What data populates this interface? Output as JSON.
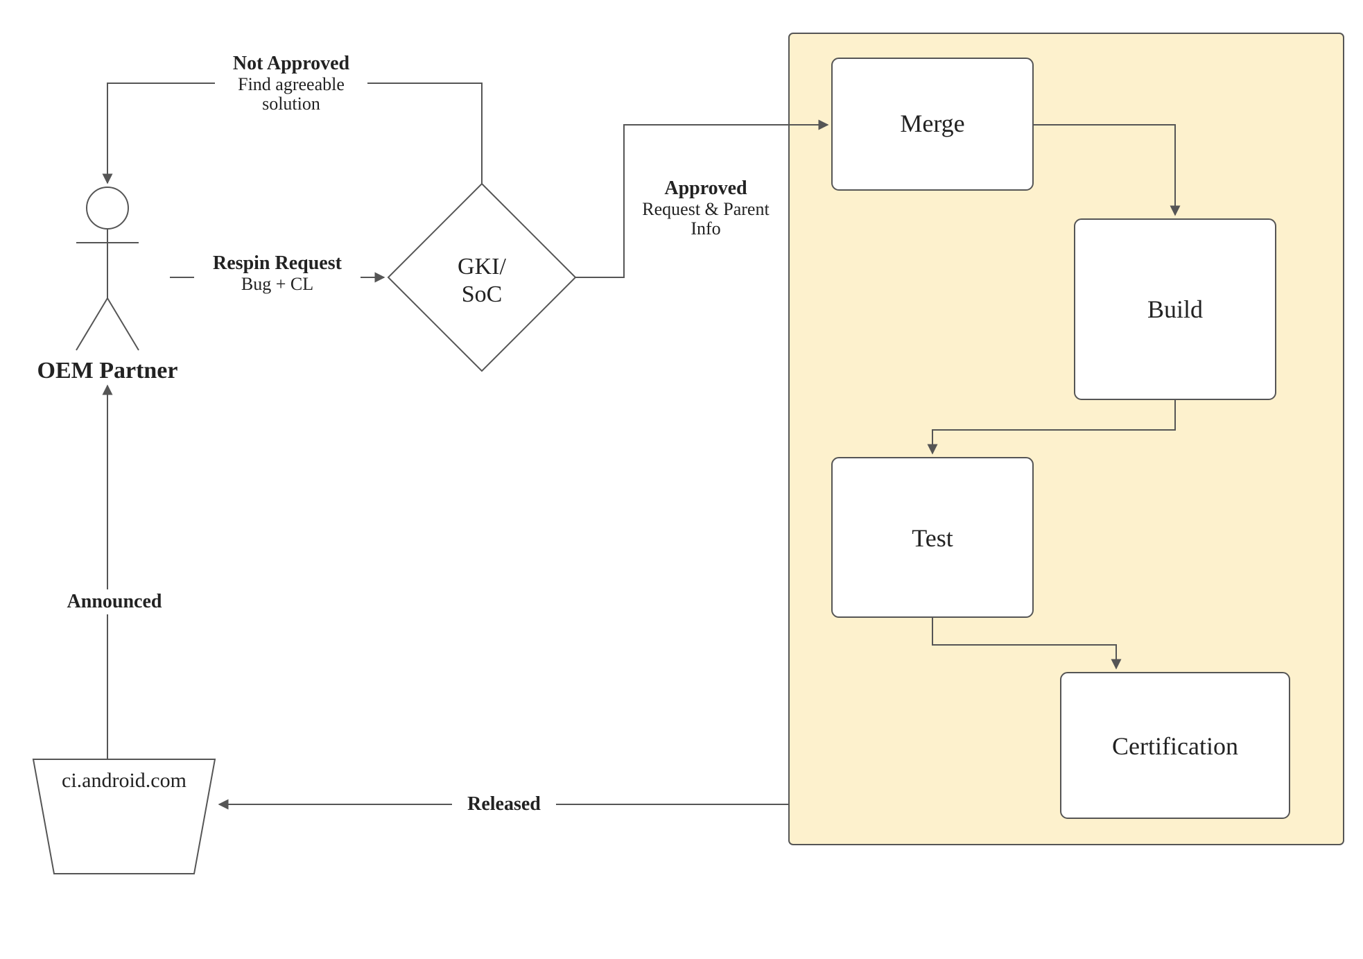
{
  "actor": {
    "label": "OEM Partner"
  },
  "decision": {
    "line1": "GKI/",
    "line2": "SoC"
  },
  "repo": {
    "label": "ci.android.com"
  },
  "pipeline": {
    "merge": "Merge",
    "build": "Build",
    "test": "Test",
    "certification": "Certification"
  },
  "edges": {
    "respin": {
      "title": "Respin Request",
      "sub": "Bug + CL"
    },
    "notApproved": {
      "title": "Not Approved",
      "sub1": "Find agreeable",
      "sub2": "solution"
    },
    "approved": {
      "title": "Approved",
      "sub1": "Request & Parent",
      "sub2": "Info"
    },
    "released": "Released",
    "announced": "Announced"
  }
}
